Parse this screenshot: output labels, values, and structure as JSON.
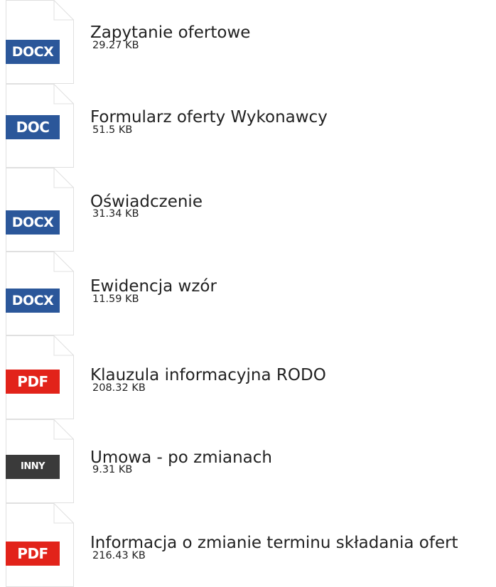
{
  "files": [
    {
      "title": "Zapytanie ofertowe",
      "size": "29.27 KB",
      "type": "DOCX",
      "badge_color": "#2b579a"
    },
    {
      "title": "Formularz oferty Wykonawcy",
      "size": "51.5 KB",
      "type": "DOC",
      "badge_color": "#2b579a"
    },
    {
      "title": "Oświadczenie",
      "size": "31.34 KB",
      "type": "DOCX",
      "badge_color": "#2b579a"
    },
    {
      "title": "Ewidencja wzór",
      "size": "11.59 KB",
      "type": "DOCX",
      "badge_color": "#2b579a"
    },
    {
      "title": "Klauzula informacyjna RODO",
      "size": "208.32 KB",
      "type": "PDF",
      "badge_color": "#e2231a"
    },
    {
      "title": "Umowa - po zmianach",
      "size": "9.31 KB",
      "type": "INNY",
      "badge_color": "#3a3a3a"
    },
    {
      "title": "Informacja o zmianie terminu składania ofert",
      "size": "216.43 KB",
      "type": "PDF",
      "badge_color": "#e2231a"
    }
  ]
}
